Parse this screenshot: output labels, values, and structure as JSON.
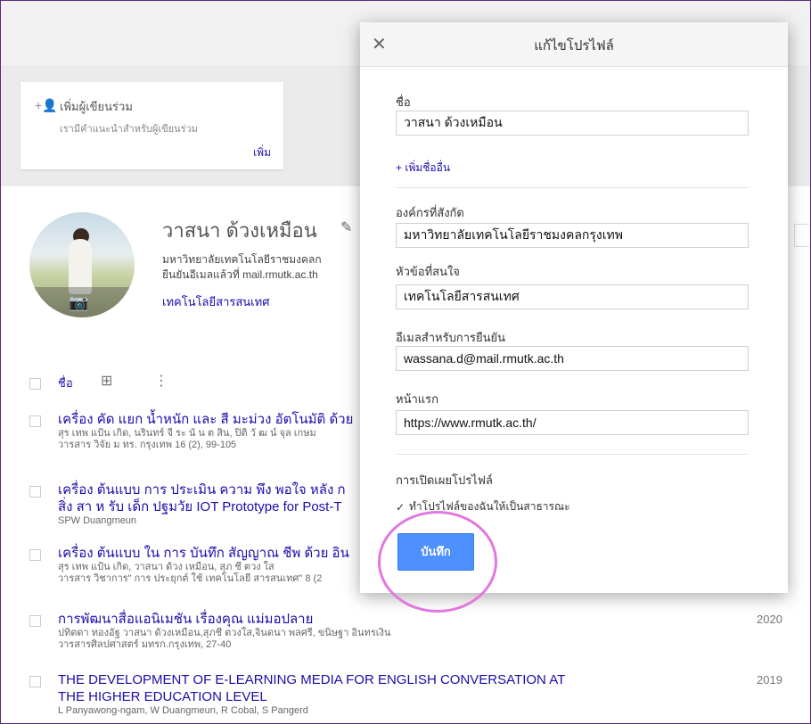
{
  "page": {
    "coauthors": {
      "title": "เพิ่มผู้เขียนร่วม",
      "hint": "เรามีคำแนะนำสำหรับผู้เขียนร่วม",
      "add_label": "เพิ่ม"
    },
    "profile": {
      "name": "วาสนา ด้วงเหมือน",
      "affiliation": "มหาวิทยาลัยเทคโนโลยีราชมงคลก",
      "verified": "ยืนยันอีเมลแล้วที่ mail.rmutk.ac.th",
      "interest": "เทคโนโลยีสารสนเทศ"
    },
    "list_header": {
      "name_label": "ชื่อ"
    },
    "articles": [
      {
        "title": "เครื่อง คัด แยก น้ำหนัก และ สี มะม่วง อัตโนมัติ ด้วย",
        "authors": "สุร เทพ แป้น เกิด, นรินทร์ จี ระ นั น ต สิน, ปิติ วั ฒ น์ จุล เกษม",
        "journal": "วารสาร วิจัย ม ทร. กรุงเทพ 16 (2), 99-105",
        "year": ""
      },
      {
        "title": "เครื่อง ต้นแบบ การ ประเมิน ความ พึง พอใจ หลัง ก",
        "title2": "สิ่ง สา ห รับ เด็ก ปฐมวัย IOT Prototype for Post-T",
        "authors": "SPW Duangmeun",
        "journal": "",
        "year": ""
      },
      {
        "title": "เครื่อง ต้นแบบ ใน การ บันทึก สัญญาณ ชีพ ด้วย อิน",
        "authors": "สุร เทพ แป้น เกิด, วาสนา ด้วง เหมือน, สุภ ชี ตวง ใส",
        "journal": "วารสาร วิชาการ\" การ ประยุกต์ ใช้ เทคโนโลยี สารสนเทศ\" 8 (2",
        "year": ""
      },
      {
        "title": "การพัฒนาสื่อแอนิเมชัน เรื่องคุณ แม่มอปลาย",
        "authors": "ปทิตดา ทองอัฐ วาสนา ด้วงเหมือน,สุภชี ตวงใส,จินดนา พลศรี, ขนิษฐา อินทรเงิน",
        "journal": "วารสารศิลปศาสตร์ มทรก.กรุงเทพ, 27-40",
        "year": "2020"
      },
      {
        "title": "THE DEVELOPMENT OF E-LEARNING MEDIA FOR ENGLISH CONVERSATION AT",
        "title2": "THE HIGHER EDUCATION LEVEL",
        "authors": "L Panyawong-ngam, W Duangmeun, R Cobal, S Pangerd",
        "journal": "",
        "year": "2019"
      }
    ]
  },
  "modal": {
    "title": "แก้ไขโปรไฟล์",
    "name_label": "ชื่อ",
    "name_value": "วาสนา ด้วงเหมือน",
    "add_name_link": "+ เพิ่มชื่ออื่น",
    "affiliation_label": "องค์กรที่สังกัด",
    "affiliation_value": "มหาวิทยาลัยเทคโนโลยีราชมงคลกรุงเทพ",
    "interests_label": "หัวข้อที่สนใจ",
    "interests_value": "เทคโนโลยีสารสนเทศ",
    "email_label": "อีเมลสำหรับการยืนยัน",
    "email_value": "wassana.d@mail.rmutk.ac.th",
    "homepage_label": "หน้าแรก",
    "homepage_value": "https://www.rmutk.ac.th/",
    "visibility_label": "การเปิดเผยโปรไฟล์",
    "public_checkbox_label": "ทำโปรไฟล์ของฉันให้เป็นสาธารณะ",
    "public_checked": true,
    "save_label": "บันทึก"
  },
  "colors": {
    "link": "#1a0dab",
    "save_button": "#4d90fe",
    "highlight_circle": "#e278de"
  }
}
